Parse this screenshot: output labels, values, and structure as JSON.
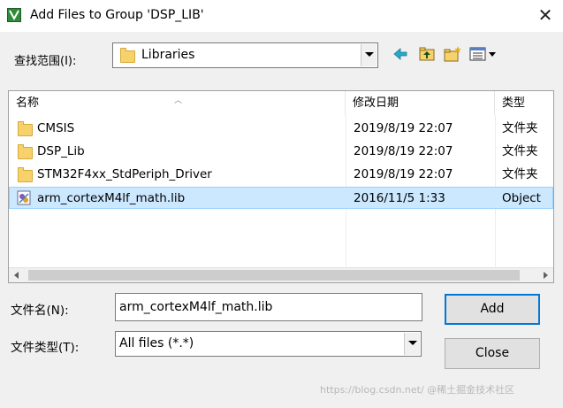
{
  "window": {
    "title": "Add Files to Group 'DSP_LIB'"
  },
  "look_in": {
    "label": "查找范围(I):",
    "value": "Libraries"
  },
  "toolbar": {
    "icons": [
      "back-arrow-icon",
      "up-folder-icon",
      "new-folder-icon",
      "view-menu-icon"
    ]
  },
  "columns": [
    {
      "label": "名称"
    },
    {
      "label": "修改日期"
    },
    {
      "label": "类型"
    }
  ],
  "files": [
    {
      "name": "CMSIS",
      "date": "2019/8/19 22:07",
      "type": "文件夹",
      "icon": "folder-icon"
    },
    {
      "name": "DSP_Lib",
      "date": "2019/8/19 22:07",
      "type": "文件夹",
      "icon": "folder-icon"
    },
    {
      "name": "STM32F4xx_StdPeriph_Driver",
      "date": "2019/8/19 22:07",
      "type": "文件夹",
      "icon": "folder-icon"
    },
    {
      "name": "arm_cortexM4lf_math.lib",
      "date": "2016/11/5 1:33",
      "type": "Object",
      "icon": "lib-file-icon",
      "selected": true
    }
  ],
  "filename": {
    "label": "文件名(N):",
    "value": "arm_cortexM4lf_math.lib"
  },
  "filetype": {
    "label": "文件类型(T):",
    "value": "All files (*.*)"
  },
  "buttons": {
    "add": "Add",
    "close": "Close"
  },
  "watermark": "https://blog.csdn.net/ @稀土掘金技术社区",
  "colors": {
    "selection": "#cce8ff",
    "selection_border": "#99d1ff",
    "default_button_border": "#0078d7"
  }
}
